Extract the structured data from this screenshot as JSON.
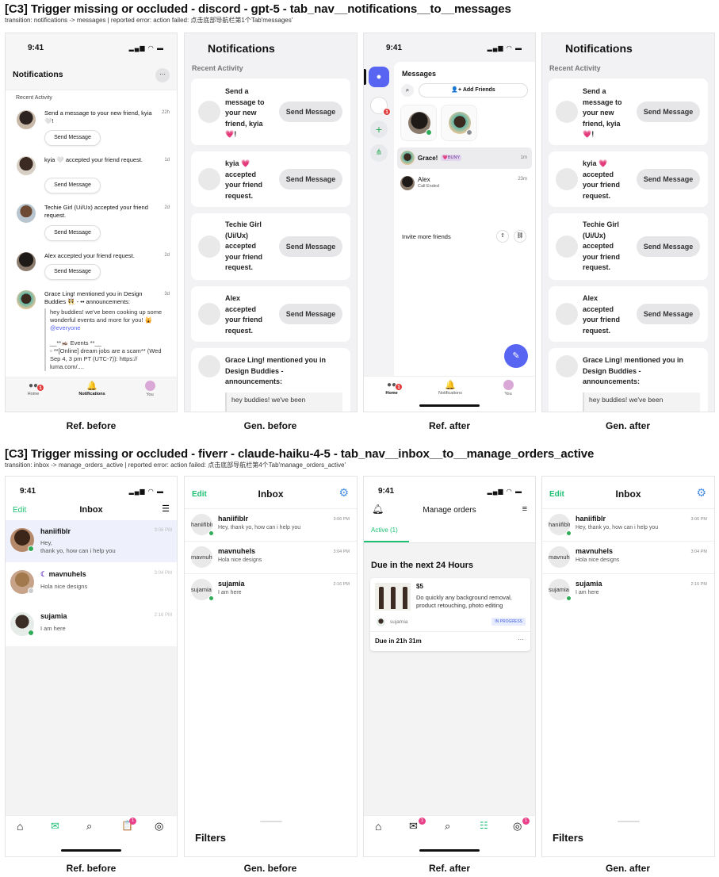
{
  "sections": [
    {
      "title": "[C3] Trigger missing or occluded - discord - gpt-5 - tab_nav__notifications__to__messages",
      "subtitle": "transition: notifications -> messages | reported error: action failed: 点击底部导航栏第1个Tab'messages'",
      "captions": [
        "Ref. before",
        "Gen. before",
        "Ref. after",
        "Gen. after"
      ]
    },
    {
      "title": "[C3] Trigger missing or occluded - fiverr - claude-haiku-4-5 - tab_nav__inbox__to__manage_orders_active",
      "subtitle": "transition: inbox -> manage_orders_active | reported error: action failed: 点击底部导航栏第4个Tab'manage_orders_active'",
      "captions": [
        "Ref. before",
        "Gen. before",
        "Ref. after",
        "Gen. after"
      ]
    }
  ],
  "discord_ref_before": {
    "time": "9:41",
    "title": "Notifications",
    "more": "···",
    "section": "Recent Activity",
    "items": [
      {
        "text": "Send a message to your new friend, kyia 🤍!",
        "time": "22h",
        "button": "Send Message"
      },
      {
        "text": "kyia 🤍 accepted your friend request.",
        "time": "1d",
        "button": "Send Message"
      },
      {
        "text": "Techie Girl (Ui/Ux) accepted your friend request.",
        "time": "2d",
        "button": "Send Message"
      },
      {
        "text": "Alex accepted your friend request.",
        "time": "2d",
        "button": "Send Message"
      },
      {
        "text": "Grace Ling! mentioned you in Design Buddies 👯 - •• announcements:",
        "time": "3d"
      }
    ],
    "quote": [
      "hey buddies! we've been cooking up some wonderful events and more for you! 🙀",
      "@everyone",
      "__**🦗 Events **__",
      "▫ **[Online] dream jobs are a scam** (Wed Sep 4, 3 pm PT (UTC-7)): https://",
      "luma.com/...."
    ],
    "tabs": [
      "Home",
      "Notifications",
      "You"
    ],
    "home_badge": "1"
  },
  "discord_gen": {
    "title": "Notifications",
    "section": "Recent Activity",
    "cards": [
      {
        "lines": [
          "Send a",
          "message to",
          "your new",
          "friend, kyia",
          "💗!"
        ],
        "button": "Send Message"
      },
      {
        "lines": [
          "kyia 💗",
          "accepted",
          "your friend",
          "request."
        ],
        "button": "Send Message"
      },
      {
        "lines": [
          "Techie Girl",
          "(Ui/Ux)",
          "accepted",
          "your friend",
          "request."
        ],
        "button": "Send Message"
      },
      {
        "lines": [
          "Alex",
          "accepted",
          "your friend",
          "request."
        ],
        "button": "Send Message"
      },
      {
        "lines": [
          "Grace Ling! mentioned you in",
          "Design Buddies -",
          "announcements:"
        ]
      }
    ],
    "quote": "hey buddies! we've been"
  },
  "discord_ref_after": {
    "time": "9:41",
    "title": "Messages",
    "add_friends": "Add Friends",
    "dms": [
      {
        "name": "Grace!",
        "tag": "💗BUNY",
        "time": "1m"
      },
      {
        "name": "Alex",
        "sub": "Call Ended",
        "time": "23m"
      }
    ],
    "invite": "Invite more friends",
    "tabs": [
      "Home",
      "Notifications",
      "You"
    ],
    "server_badge": "1",
    "home_badge": "1"
  },
  "fiverr_ref_before": {
    "time": "9:41",
    "edit": "Edit",
    "title": "Inbox",
    "rows": [
      {
        "name": "haniifiblr",
        "msg1": "Hey,",
        "msg2": "thank yo, how can i help you",
        "time": "3:06 PM"
      },
      {
        "name": "mavnuhels",
        "msg1": "Hola nice designs",
        "time": "3:04 PM"
      },
      {
        "name": "sujamia",
        "msg1": "I am here",
        "time": "2:16 PM"
      }
    ]
  },
  "fiverr_gen": {
    "edit": "Edit",
    "title": "Inbox",
    "rows": [
      {
        "avatar": "haniifiblr",
        "name": "haniifiblr",
        "msg": "Hey, thank yo, how can i help you",
        "time": "3:06 PM"
      },
      {
        "avatar": "mavnuhels",
        "name": "mavnuhels",
        "msg": "Hola nice designs",
        "time": "3:04 PM"
      },
      {
        "avatar": "sujamia",
        "name": "sujamia",
        "msg": "I am here",
        "time": "2:16 PM"
      }
    ],
    "filters": "Filters"
  },
  "fiverr_ref_after": {
    "time": "9:41",
    "title": "Manage orders",
    "tab": "Active (1)",
    "heading": "Due in the next 24 Hours",
    "order": {
      "price": "$5",
      "desc1": "Do quickly any background removal,",
      "desc2": "product retouching, photo editing",
      "buyer": "sujamia",
      "status": "IN PROGRESS",
      "due": "Due in 21h 31m",
      "more": "···"
    },
    "inbox_badge": "1",
    "profile_badge": "1"
  },
  "fiverr_ref_before_badges": {
    "orders_badge": "1"
  },
  "colors": {
    "discord_blurple": "#5865f2",
    "fiverr_green": "#1dbf73",
    "online": "#2faa56",
    "badge_pink": "#e8438a"
  }
}
